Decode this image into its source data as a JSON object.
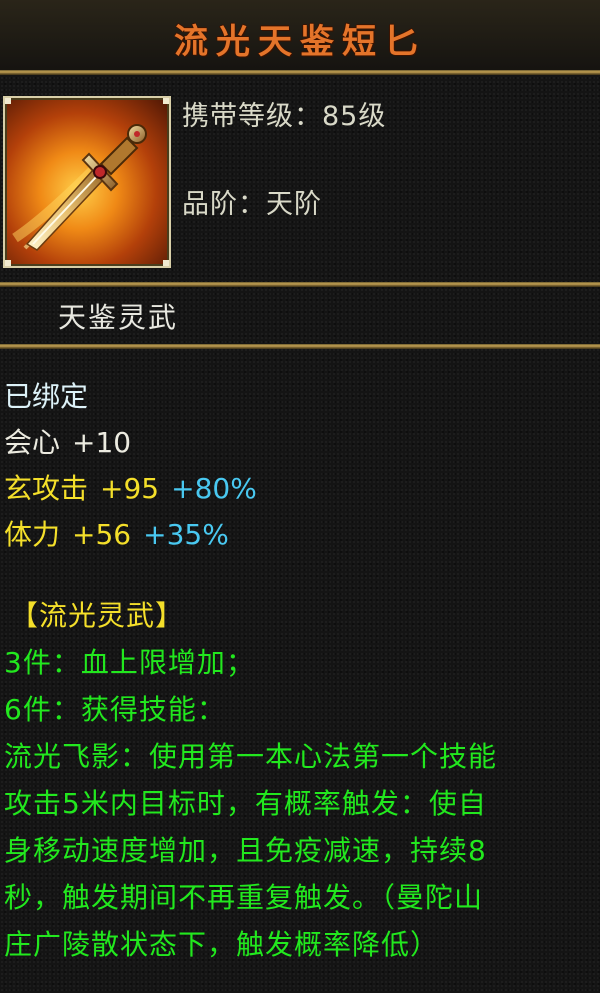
{
  "item": {
    "name": "流光天鉴短匕",
    "level_label": "携带等级：",
    "level_value": "85级",
    "grade_label": "品阶：",
    "grade_value": "天阶",
    "category": "天鉴灵武",
    "icon": "dagger-icon"
  },
  "stats": {
    "bound": "已绑定",
    "crit_name": "会心",
    "crit_value": "+10",
    "attack_name": "玄攻击",
    "attack_value": "+95",
    "attack_bonus": "+80%",
    "stamina_name": "体力",
    "stamina_value": "+56",
    "stamina_bonus": "+35%"
  },
  "set_bonus": {
    "title": "【流光灵武】",
    "lines": [
      "3件：血上限增加；",
      "6件：获得技能：",
      "流光飞影：使用第一本心法第一个技能",
      "攻击5米内目标时，有概率触发：使自",
      "身移动速度增加，且免疫减速，持续8",
      "秒，触发期间不再重复触发。（曼陀山",
      "庄广陵散状态下，触发概率降低）"
    ]
  },
  "colors": {
    "title": "#e4742a",
    "bound": "#ddf2f8",
    "stat_yellow": "#f4df2a",
    "bonus_cyan": "#49c8f0",
    "set_green": "#22e81e",
    "frame_gold": "#c9a656"
  }
}
